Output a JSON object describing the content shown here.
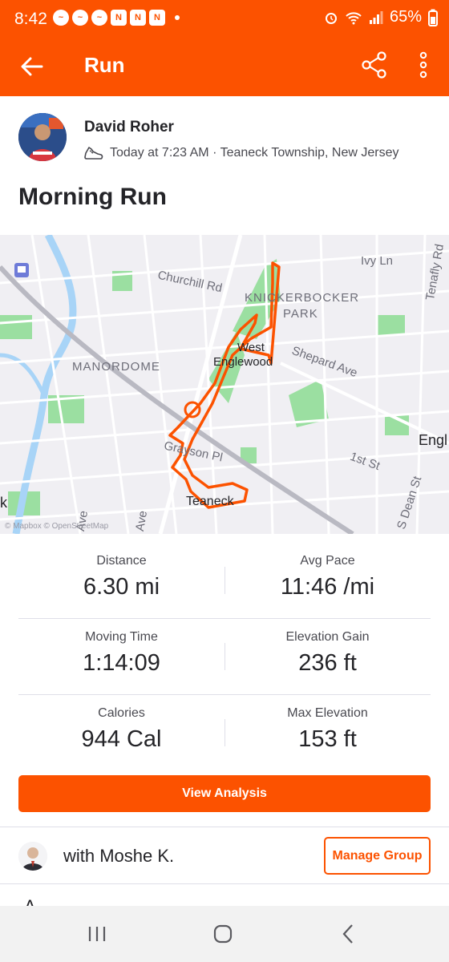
{
  "status_bar": {
    "time": "8:42",
    "battery": "65%"
  },
  "app_bar": {
    "title": "Run"
  },
  "athlete": {
    "name": "David Roher",
    "activity_info": "Today at 7:23 AM · Teaneck Township, New Jersey"
  },
  "activity": {
    "title": "Morning Run"
  },
  "map": {
    "labels": [
      "Ivy Ln",
      "Churchill Rd",
      "KNICKERBOCKER",
      "PARK",
      "West",
      "Englewood",
      "Shepard Ave",
      "MANORDOME",
      "Tenafly Rd",
      "Engl",
      "1st St",
      "S Dean St",
      "Grayson Pl",
      "Teaneck",
      "Ave",
      "Ave",
      "k"
    ],
    "attribution": "© Mapbox © OpenStreetMap",
    "route_color": "#fc5200"
  },
  "stats": [
    {
      "label": "Distance",
      "value": "6.30 mi"
    },
    {
      "label": "Avg Pace",
      "value": "11:46 /mi"
    },
    {
      "label": "Moving Time",
      "value": "1:14:09"
    },
    {
      "label": "Elevation Gain",
      "value": "236 ft"
    },
    {
      "label": "Calories",
      "value": "944 Cal"
    },
    {
      "label": "Max Elevation",
      "value": "153 ft"
    }
  ],
  "actions": {
    "view_analysis": "View Analysis",
    "manage_group": "Manage Group"
  },
  "group": {
    "text": "with Moshe K."
  },
  "peek_text": "A",
  "colors": {
    "brand": "#fc5200",
    "text": "#242428"
  }
}
